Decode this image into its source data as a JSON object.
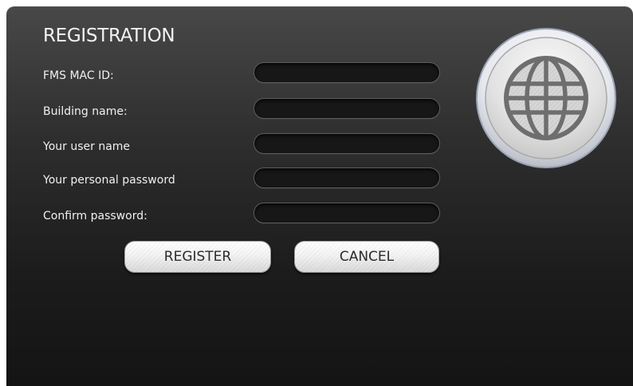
{
  "dialog": {
    "title": "REGISTRATION"
  },
  "fields": [
    {
      "label": "FMS MAC ID:",
      "value": "",
      "type": "text"
    },
    {
      "label": "Building name:",
      "value": "",
      "type": "text"
    },
    {
      "label": "Your user name",
      "value": "",
      "type": "text"
    },
    {
      "label": "Your personal password",
      "value": "",
      "type": "password"
    },
    {
      "label": "Confirm password:",
      "value": "",
      "type": "password"
    }
  ],
  "buttons": {
    "register_label": "REGISTER",
    "cancel_label": "CANCEL"
  },
  "icons": {
    "emblem": "globe-icon"
  },
  "colors": {
    "panel_top": "#484848",
    "panel_bottom": "#141414",
    "text": "#f0f0f0",
    "input_bg": "#171717",
    "button_face": "#f3f3f3",
    "globe_accent": "#6e6e6e"
  }
}
